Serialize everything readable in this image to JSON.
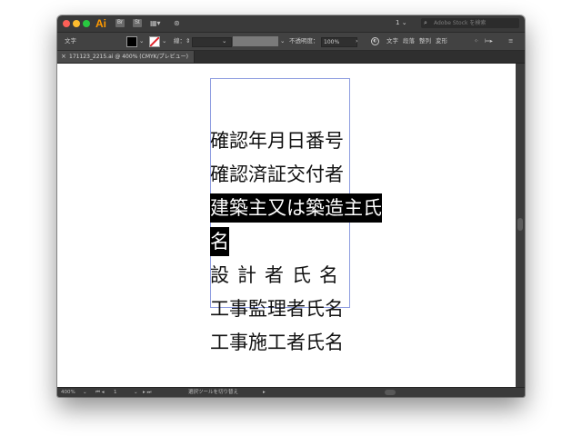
{
  "app": {
    "logo": "Ai",
    "br_label": "Br",
    "st_label": "St"
  },
  "titlebar": {
    "page_select": "1",
    "search_placeholder": "Adobe Stock を検索"
  },
  "control_bar": {
    "object_type": "文字",
    "stroke_label": "線：",
    "opacity_label": "不透明度：",
    "opacity_value": "100%",
    "menu_character": "文字",
    "menu_paragraph": "段落",
    "menu_align": "整列",
    "menu_transform": "変形"
  },
  "document_tab": {
    "close_glyph": "×",
    "title": "171123_2215.ai @ 400% (CMYK/プレビュー)"
  },
  "canvas_text": {
    "lines": [
      "確認年月日番号",
      "確認済証交付者",
      "建築主又は築造主氏",
      "名",
      "設計者氏名",
      "工事監理者氏名",
      "工事施工者氏名"
    ]
  },
  "status_bar": {
    "zoom": "400%",
    "artboard": "1",
    "tool_hint": "選択ツールを切り替え"
  },
  "colors": {
    "chrome_dark": "#3a3a3a",
    "selection_box": "#8d9ce0",
    "fill": "#000000",
    "stroke_none_slash": "#e0242b"
  }
}
